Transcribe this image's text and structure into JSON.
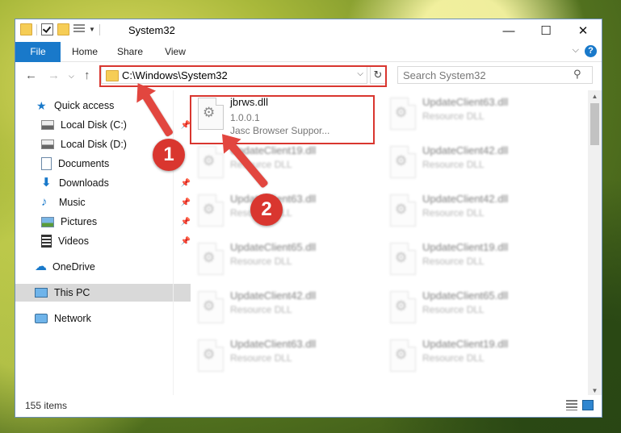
{
  "window": {
    "title": "System32"
  },
  "ribbon": {
    "tabs": [
      {
        "label": "File",
        "active": true
      },
      {
        "label": "Home"
      },
      {
        "label": "Share"
      },
      {
        "label": "View"
      }
    ],
    "help": "?"
  },
  "navigation": {
    "address": "C:\\Windows\\System32",
    "search_placeholder": "Search System32"
  },
  "sidebar": {
    "items": [
      {
        "label": "Quick access",
        "icon": "star-icon"
      },
      {
        "label": "Local Disk (C:)",
        "icon": "drive-icon",
        "pinned": true
      },
      {
        "label": "Local Disk (D:)",
        "icon": "drive-icon"
      },
      {
        "label": "Documents",
        "icon": "documents-icon"
      },
      {
        "label": "Downloads",
        "icon": "download-icon",
        "pinned": true
      },
      {
        "label": "Music",
        "icon": "music-icon",
        "pinned": true
      },
      {
        "label": "Pictures",
        "icon": "pictures-icon",
        "pinned": true
      },
      {
        "label": "Videos",
        "icon": "videos-icon",
        "pinned": true
      },
      {
        "label": "OneDrive",
        "icon": "onedrive-icon"
      },
      {
        "label": "This PC",
        "icon": "computer-icon",
        "selected": true
      },
      {
        "label": "Network",
        "icon": "network-icon"
      }
    ]
  },
  "files": {
    "highlighted": {
      "name": "jbrws.dll",
      "version": "1.0.0.1",
      "description": "Jasc Browser Suppor..."
    },
    "blurred": [
      {
        "name": "UpdateClient63.dll",
        "type": "Resource DLL"
      },
      {
        "name": "UpdateClient19.dll",
        "type": "Resource DLL"
      },
      {
        "name": "UpdateClient42.dll",
        "type": "Resource DLL"
      },
      {
        "name": "UpdateClient63.dll",
        "type": "Resource DLL"
      },
      {
        "name": "UpdateClient42.dll",
        "type": "Resource DLL"
      },
      {
        "name": "UpdateClient65.dll",
        "type": "Resource DLL"
      },
      {
        "name": "UpdateClient19.dll",
        "type": "Resource DLL"
      },
      {
        "name": "UpdateClient42.dll",
        "type": "Resource DLL"
      },
      {
        "name": "UpdateClient65.dll",
        "type": "Resource DLL"
      },
      {
        "name": "UpdateClient63.dll",
        "type": "Resource DLL"
      },
      {
        "name": "UpdateClient19.dll",
        "type": "Resource DLL"
      }
    ]
  },
  "status": {
    "item_count": "155 items"
  },
  "annotations": {
    "step1": "1",
    "step2": "2"
  },
  "colors": {
    "accent": "#1979ca",
    "highlight_red": "#d9362f"
  }
}
